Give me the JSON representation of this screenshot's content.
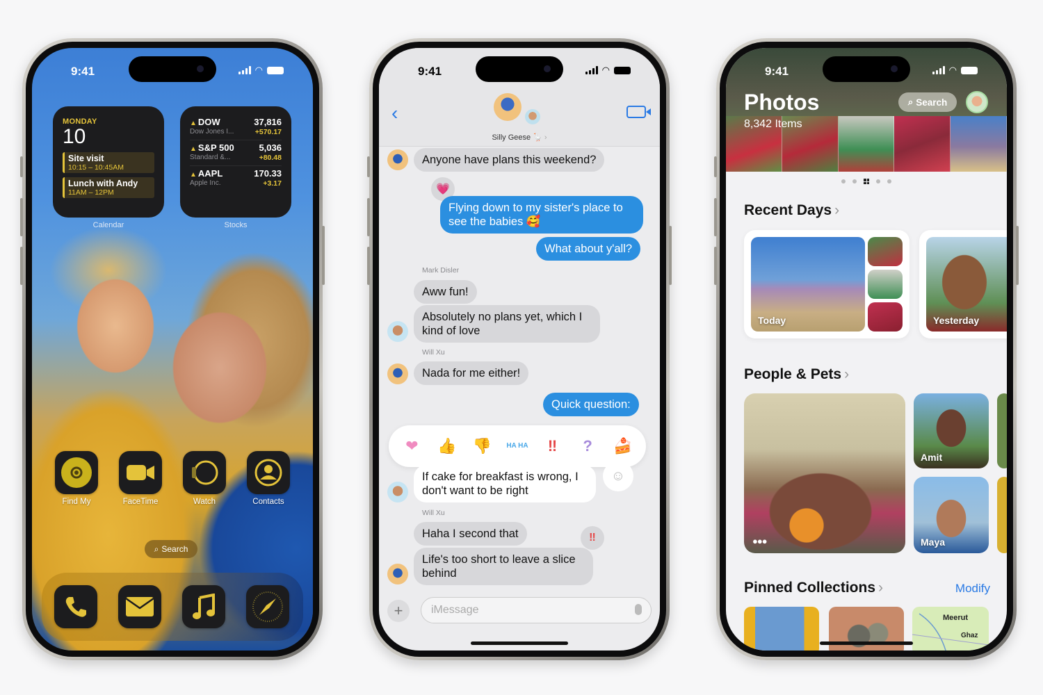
{
  "status_bar": {
    "time": "9:41"
  },
  "home_screen": {
    "calendar_widget": {
      "label": "Calendar",
      "weekday": "MONDAY",
      "date": "10",
      "events": [
        {
          "title": "Site visit",
          "time": "10:15 – 10:45AM"
        },
        {
          "title": "Lunch with Andy",
          "time": "11AM – 12PM"
        }
      ]
    },
    "stocks_widget": {
      "label": "Stocks",
      "stocks": [
        {
          "symbol": "DOW",
          "name": "Dow Jones I...",
          "price": "37,816",
          "change": "+570.17"
        },
        {
          "symbol": "S&P 500",
          "name": "Standard &...",
          "price": "5,036",
          "change": "+80.48"
        },
        {
          "symbol": "AAPL",
          "name": "Apple Inc.",
          "price": "170.33",
          "change": "+3.17"
        }
      ]
    },
    "apps": [
      {
        "label": "Find My",
        "icon": "find-my-icon"
      },
      {
        "label": "FaceTime",
        "icon": "facetime-icon"
      },
      {
        "label": "Watch",
        "icon": "watch-icon"
      },
      {
        "label": "Contacts",
        "icon": "contacts-icon"
      }
    ],
    "search_label": "Search",
    "dock": [
      {
        "icon": "phone-icon"
      },
      {
        "icon": "mail-icon"
      },
      {
        "icon": "music-icon"
      },
      {
        "icon": "safari-icon"
      }
    ],
    "accent_color": "#e4c33a"
  },
  "messages": {
    "group_name": "Silly Geese 🪿",
    "accent_color": "#2b8fe0",
    "thread": [
      {
        "from": "Will Xu",
        "direction": "in",
        "text": "Anyone have plans this weekend?"
      },
      {
        "from": "me",
        "direction": "out",
        "text": "Flying down to my sister's place to see the babies 🥰",
        "tapback": "heart"
      },
      {
        "from": "me",
        "direction": "out",
        "text": "What about y'all?"
      },
      {
        "from": "Mark Disler",
        "direction": "in",
        "text": "Aww fun!"
      },
      {
        "from": "Mark Disler",
        "direction": "in",
        "text": "Absolutely no plans yet, which I kind of love"
      },
      {
        "from": "Will Xu",
        "direction": "in",
        "text": "Nada for me either!"
      },
      {
        "from": "me",
        "direction": "out",
        "text": "Quick question:"
      },
      {
        "from": "Mark Disler",
        "direction": "in",
        "text": "If cake for breakfast is wrong, I don't want to be right"
      },
      {
        "from": "Will Xu",
        "direction": "in",
        "text": "Haha I second that"
      },
      {
        "from": "Will Xu",
        "direction": "in",
        "text": "Life's too short to leave a slice behind",
        "tapback": "exclamation"
      }
    ],
    "sender_labels": {
      "mark": "Mark Disler",
      "will": "Will Xu"
    },
    "reactions": [
      "❤",
      "👍",
      "👎",
      "HA HA",
      "‼",
      "?",
      "🍰"
    ],
    "compose_placeholder": "iMessage"
  },
  "photos": {
    "title": "Photos",
    "item_count": "8,342 Items",
    "search_label": "Search",
    "sections": {
      "recent_days": {
        "title": "Recent Days",
        "tiles": [
          "Today",
          "Yesterday"
        ]
      },
      "people_pets": {
        "title": "People & Pets",
        "people": [
          "Amit",
          "Maya"
        ]
      },
      "pinned": {
        "title": "Pinned Collections",
        "action": "Modify",
        "map_labels": [
          "Meerut",
          "Ghaz"
        ]
      }
    }
  }
}
